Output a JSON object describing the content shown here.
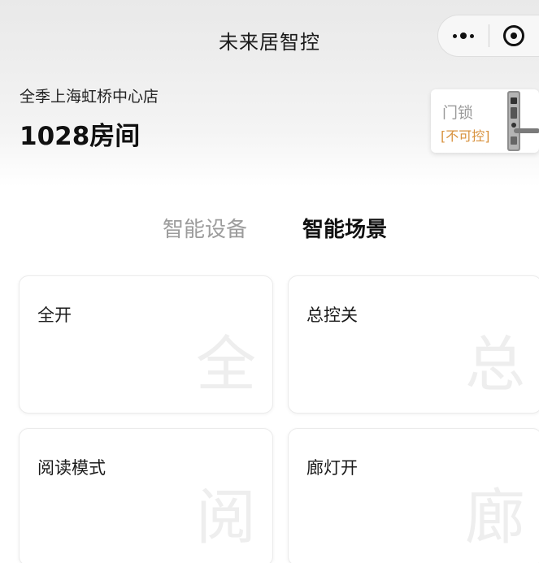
{
  "nav": {
    "title": "未来居智控"
  },
  "capsule": {
    "more_icon": "more-dots-icon",
    "target_icon": "target-icon"
  },
  "room": {
    "hotel": "全季上海虹桥中心店",
    "name": "1028房间"
  },
  "lock": {
    "label": "门锁",
    "status": "[不可控]",
    "status_color": "#d8913c"
  },
  "tabs": [
    {
      "label": "智能设备",
      "active": false
    },
    {
      "label": "智能场景",
      "active": true
    }
  ],
  "scenes": [
    {
      "label": "全开",
      "mark": "全"
    },
    {
      "label": "总控关",
      "mark": "总"
    },
    {
      "label": "阅读模式",
      "mark": "阅"
    },
    {
      "label": "廊灯开",
      "mark": "廊"
    }
  ]
}
